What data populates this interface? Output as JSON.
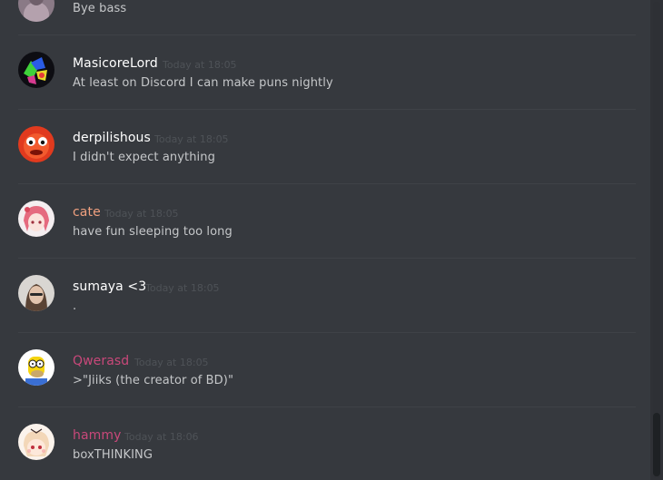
{
  "messages": [
    {
      "username": "",
      "timestamp": "",
      "text": "Bye bass",
      "name_color": "#ffffff",
      "avatar": "partial-avatar"
    },
    {
      "username": "MasicoreLord",
      "timestamp": "Today at 18:05",
      "text": "At least on Discord I can make puns nightly",
      "name_color": "#ffffff",
      "avatar": "colorful-abstract-avatar"
    },
    {
      "username": "derpilishous",
      "timestamp": "Today at 18:05",
      "text": "I didn't expect anything",
      "name_color": "#ffffff",
      "avatar": "red-creature-avatar"
    },
    {
      "username": "cate",
      "timestamp": "Today at 18:05",
      "text": "have fun sleeping too long",
      "name_color": "#f0a07f",
      "avatar": "anime-girl-avatar"
    },
    {
      "username": "sumaya <3",
      "timestamp": "Today at 18:05",
      "text": ".",
      "name_color": "#ffffff",
      "avatar": "photo-avatar"
    },
    {
      "username": "Qwerasd",
      "timestamp": "Today at 18:05",
      "text": ">\"Jiiks (the creator of BD)\"",
      "name_color": "#c9487a",
      "avatar": "cartoon-character-avatar"
    },
    {
      "username": "hammy",
      "timestamp": "Today at 18:06",
      "text": "boxTHINKING",
      "name_color": "#c9487a",
      "avatar": "anime-girl-avatar-2"
    }
  ]
}
